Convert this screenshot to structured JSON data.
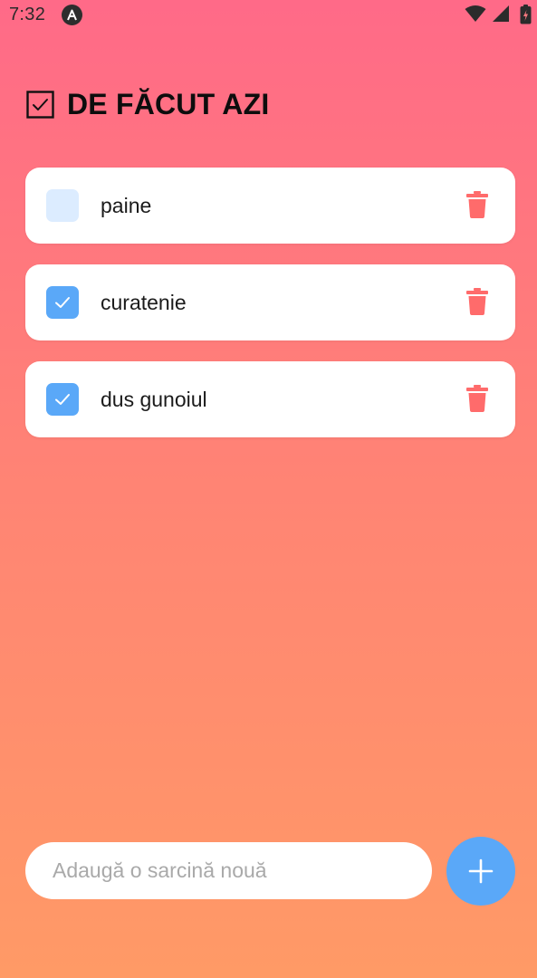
{
  "status_bar": {
    "time": "7:32",
    "app_icon": "a-icon",
    "icons": [
      "wifi-icon",
      "signal-icon",
      "battery-icon"
    ]
  },
  "header": {
    "icon": "checkbox-icon",
    "title": "DE FĂCUT AZI"
  },
  "tasks": [
    {
      "label": "paine",
      "done": false,
      "delete_icon": "trash-icon"
    },
    {
      "label": "curatenie",
      "done": true,
      "delete_icon": "trash-icon"
    },
    {
      "label": "dus gunoiul",
      "done": true,
      "delete_icon": "trash-icon"
    }
  ],
  "new_task": {
    "placeholder": "Adaugă o sarcină nouă",
    "value": ""
  },
  "add_button": {
    "icon": "plus-icon"
  },
  "colors": {
    "gradient_top": "#ff6a88",
    "gradient_bottom": "#ff9a66",
    "accent_blue": "#5aa8f8",
    "unchecked_box": "#dcecff",
    "delete_red": "#ff6b6b",
    "card_bg": "#ffffff"
  }
}
